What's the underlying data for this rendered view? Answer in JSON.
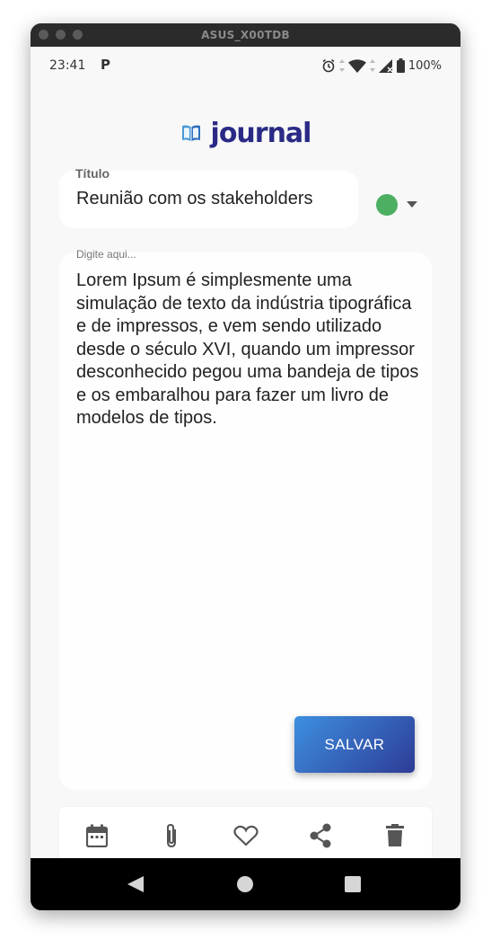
{
  "window": {
    "title": "ASUS_X00TDB"
  },
  "status_bar": {
    "time": "23:41",
    "notification_icon": "P",
    "battery": "100%"
  },
  "app": {
    "name": "journal",
    "brand_color": "#2a2a86"
  },
  "form": {
    "title_label": "Título",
    "title_value": "Reunião com os stakeholders",
    "selected_color": "#4caf62",
    "body_placeholder": "Digite aqui...",
    "body_text": "Lorem Ipsum é simplesmente uma simulação de texto da indústria tipográfica e de impressos, e vem sendo utilizado desde o século XVI, quando um impressor desconhecido pegou uma bandeja de tipos e os embaralhou para fazer um livro de modelos de tipos.",
    "save_label": "SALVAR"
  },
  "toolbar": {
    "icons": [
      "calendar-icon",
      "attach-icon",
      "heart-icon",
      "share-icon",
      "delete-icon"
    ]
  },
  "nav": {
    "icons": [
      "back-icon",
      "home-icon",
      "recents-icon"
    ]
  }
}
